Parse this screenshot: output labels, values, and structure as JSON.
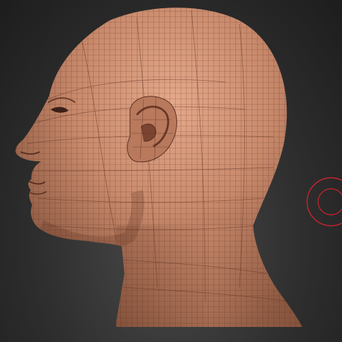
{
  "viewport": {
    "background_color": "#2e2e2e",
    "model": {
      "name": "head-sculpt",
      "material_color": "#c98a6c",
      "wireframe_color": "#5a2f20",
      "view": "left-profile"
    },
    "brush_cursor": {
      "icon": "brush-circle-icon",
      "color": "#d0232d"
    }
  }
}
